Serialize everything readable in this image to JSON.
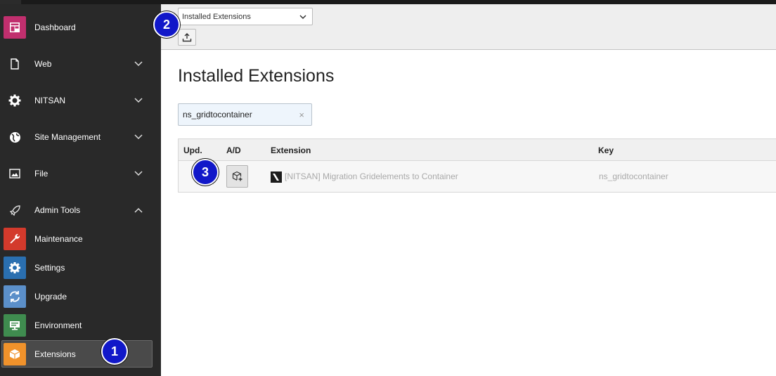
{
  "sidebar": {
    "items": [
      {
        "label": "Dashboard",
        "icon": "dashboard-icon",
        "color": "#c12f6e"
      },
      {
        "label": "Web",
        "icon": "page-icon",
        "expandable": true
      },
      {
        "label": "NITSAN",
        "icon": "gear-icon",
        "expandable": true
      },
      {
        "label": "Site Management",
        "icon": "globe-icon",
        "expandable": true
      },
      {
        "label": "File",
        "icon": "image-icon",
        "expandable": true
      },
      {
        "label": "Admin Tools",
        "icon": "rocket-icon",
        "expanded": true
      },
      {
        "label": "Maintenance",
        "icon": "wrench-icon",
        "color": "#d33a2c"
      },
      {
        "label": "Settings",
        "icon": "settings-icon",
        "color": "#2a6fb0"
      },
      {
        "label": "Upgrade",
        "icon": "refresh-icon",
        "color": "#5b8fc9"
      },
      {
        "label": "Environment",
        "icon": "monitor-icon",
        "color": "#3f8c4f"
      },
      {
        "label": "Extensions",
        "icon": "box-icon",
        "color": "#f0922b",
        "active": true
      }
    ]
  },
  "docheader": {
    "select_value": "Installed Extensions",
    "upload_icon": "upload-icon"
  },
  "main": {
    "title": "Installed Extensions",
    "search_value": "ns_gridtocontainer",
    "search_clear": "×",
    "table": {
      "headers": [
        "Upd.",
        "A/D",
        "Extension",
        "Key"
      ],
      "rows": [
        {
          "extension": "[NITSAN] Migration Gridelements to Container",
          "key": "ns_gridtocontainer"
        }
      ]
    }
  },
  "badges": [
    "1",
    "2",
    "3"
  ]
}
